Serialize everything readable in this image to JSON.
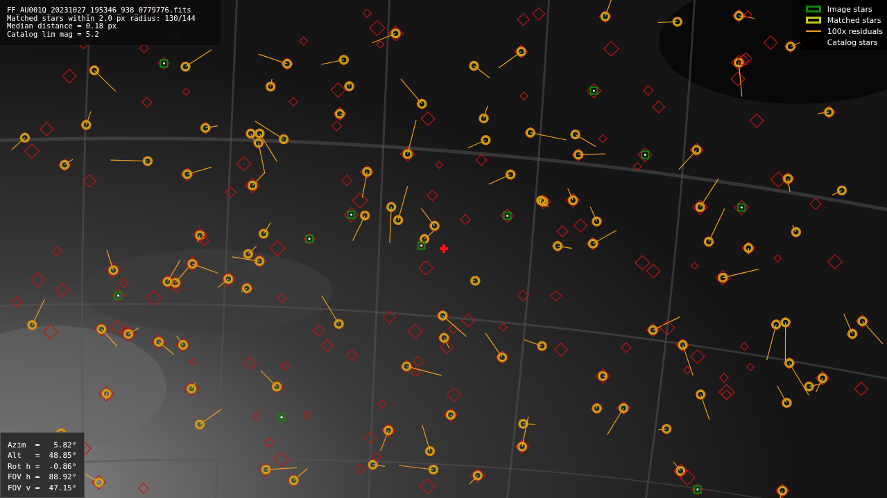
{
  "info": {
    "lines": [
      "FF_AU001Q_20231027_195346_938_0779776.fits",
      "Matched stars within 2.0 px radius: 130/144",
      "Median distance = 0.18 px",
      "Catalog lim mag = 5.2"
    ]
  },
  "legend": [
    {
      "label": "Image stars",
      "kind": "box",
      "color": "#0a8a0a"
    },
    {
      "label": "Matched stars",
      "kind": "box",
      "color": "#c8c81e"
    },
    {
      "label": "100x residuals",
      "kind": "line",
      "color": "#f0a020"
    },
    {
      "label": "Catalog stars",
      "kind": "none"
    }
  ],
  "pointing": {
    "lines": [
      "Azim  =   5.82°",
      "Alt   =  48.85°",
      "Rot h =  -0.86°",
      "FOV h =  88.92°",
      "FOV v =  47.15°"
    ]
  }
}
